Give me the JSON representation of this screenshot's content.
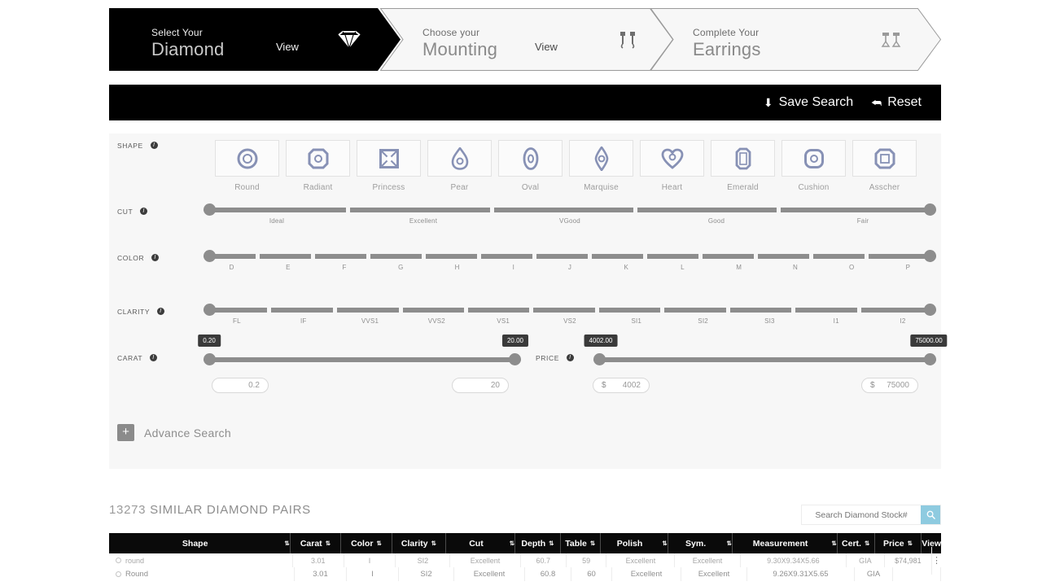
{
  "steps": [
    {
      "small": "Select Your",
      "big": "Diamond",
      "view": "View",
      "icon": "diamond-icon",
      "active": true
    },
    {
      "small": "Choose your",
      "big": "Mounting",
      "view": "View",
      "icon": "earring-mounting-icon",
      "active": false
    },
    {
      "small": "Complete Your",
      "big": "Earrings",
      "view": "",
      "icon": "earrings-icon",
      "active": false
    }
  ],
  "toolbar": {
    "save_label": "Save Search",
    "save_icon": "download-arrow-icon",
    "reset_label": "Reset",
    "reset_icon": "undo-arrow-icon"
  },
  "filters": {
    "shape": {
      "label": "SHAPE",
      "items": [
        "Round",
        "Radiant",
        "Princess",
        "Pear",
        "Oval",
        "Marquise",
        "Heart",
        "Emerald",
        "Cushion",
        "Asscher"
      ]
    },
    "cut": {
      "label": "CUT",
      "ticks": [
        "Ideal",
        "Excellent",
        "VGood",
        "Good",
        "Fair"
      ]
    },
    "color": {
      "label": "COLOR",
      "ticks": [
        "D",
        "E",
        "F",
        "G",
        "H",
        "I",
        "J",
        "K",
        "L",
        "M",
        "N",
        "O",
        "P"
      ]
    },
    "clarity": {
      "label": "CLARITY",
      "ticks": [
        "FL",
        "IF",
        "VVS1",
        "VVS2",
        "VS1",
        "VS2",
        "SI1",
        "SI2",
        "SI3",
        "I1",
        "I2"
      ]
    },
    "carat": {
      "label": "CARAT",
      "bubble_min": "0.20",
      "bubble_max": "20.00",
      "input_min": "0.2",
      "input_max": "20"
    },
    "price": {
      "label": "PRICE",
      "bubble_min": "4002.00",
      "bubble_max": "75000.00",
      "currency": "$",
      "input_min": "4002",
      "input_max": "75000"
    },
    "advance_search": "Advance Search"
  },
  "results": {
    "count": "13273",
    "title": "SIMILAR DIAMOND PAIRS",
    "search_placeholder": "Search Diamond Stock#",
    "search_value": "",
    "search_icon": "search-icon",
    "columns": [
      {
        "label": "Shape",
        "sortable": true
      },
      {
        "label": "Carat",
        "sortable": true
      },
      {
        "label": "Color",
        "sortable": true
      },
      {
        "label": "Clarity",
        "sortable": true
      },
      {
        "label": "Cut",
        "sortable": true
      },
      {
        "label": "Depth",
        "sortable": true
      },
      {
        "label": "Table",
        "sortable": true
      },
      {
        "label": "Polish",
        "sortable": true
      },
      {
        "label": "Sym.",
        "sortable": true
      },
      {
        "label": "Measurement",
        "sortable": true
      },
      {
        "label": "Cert.",
        "sortable": true
      },
      {
        "label": "Price",
        "sortable": true
      },
      {
        "label": "View",
        "sortable": false
      }
    ],
    "rows": [
      {
        "shape": "round",
        "carat": "3.01",
        "color": "I",
        "clarity": "SI2",
        "cut": "Excellent",
        "depth": "60.7",
        "table": "59",
        "polish": "Excellent",
        "sym": "Excellent",
        "measurement": "9.30X9.34X5.66",
        "cert": "GIA",
        "price": "$74,981",
        "view": "⋮"
      },
      {
        "shape": "Round",
        "carat": "3.01",
        "color": "I",
        "clarity": "SI2",
        "cut": "Excellent",
        "depth": "60.8",
        "table": "60",
        "polish": "Excellent",
        "sym": "Excellent",
        "measurement": "9.26X9.31X5.65",
        "cert": "GIA",
        "price": "",
        "view": ""
      }
    ]
  },
  "colors": {
    "black": "#000000",
    "panel": "#f7f7f7",
    "slider": "#8d8d8d",
    "shape_icon": "#8791b5",
    "search_button": "#8ecbe0"
  }
}
